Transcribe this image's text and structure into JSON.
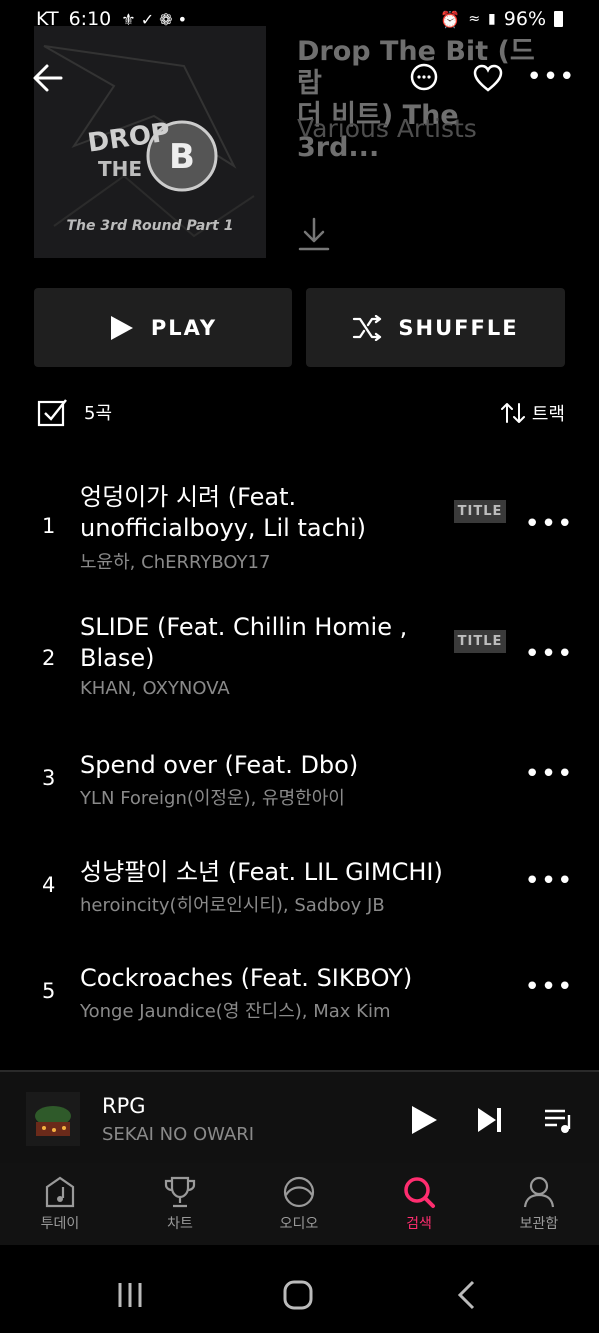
{
  "status_bar": {
    "carrier": "KT",
    "time": "6:10",
    "battery": "96%"
  },
  "album": {
    "title": "Drop The Bit (드랍\n더 비트) The 3rd...",
    "artist": "Various Artists",
    "cover_text_main": "DROP THE BIT",
    "cover_text_sub": "The 3rd Round Part 1"
  },
  "actions": {
    "play_label": "PLAY",
    "shuffle_label": "SHUFFLE"
  },
  "list_header": {
    "count_label": "5곡",
    "sort_label": "트랙"
  },
  "tracks": [
    {
      "number": "1",
      "title": "엉덩이가 시려 (Feat. unofficialboyy, Lil tachi)",
      "artist": "노윤하, ChERRYBOY17",
      "badge": "TITLE"
    },
    {
      "number": "2",
      "title": "SLIDE (Feat. Chillin Homie , Blase)",
      "artist": "KHAN, OXYNOVA",
      "badge": "TITLE"
    },
    {
      "number": "3",
      "title": "Spend over (Feat. Dbo)",
      "artist": "YLN Foreign(이정운), 유명한아이",
      "badge": ""
    },
    {
      "number": "4",
      "title": "성냥팔이 소년 (Feat. LIL GIMCHI)",
      "artist": "heroincity(히어로인시티), Sadboy JB",
      "badge": ""
    },
    {
      "number": "5",
      "title": "Cockroaches (Feat. SIKBOY)",
      "artist": "Yonge Jaundice(영 잔디스), Max Kim",
      "badge": ""
    }
  ],
  "now_playing": {
    "title": "RPG",
    "artist": "SEKAI NO OWARI"
  },
  "bottom_nav": [
    {
      "label": "투데이",
      "icon": "music-note-icon",
      "active": false
    },
    {
      "label": "차트",
      "icon": "trophy-icon",
      "active": false
    },
    {
      "label": "오디오",
      "icon": "audio-icon",
      "active": false
    },
    {
      "label": "검색",
      "icon": "search-icon",
      "active": true
    },
    {
      "label": "보관함",
      "icon": "person-icon",
      "active": false
    }
  ],
  "colors": {
    "accent": "#ff2d6f",
    "background": "#000000",
    "button_bg": "#1f1f1f"
  }
}
